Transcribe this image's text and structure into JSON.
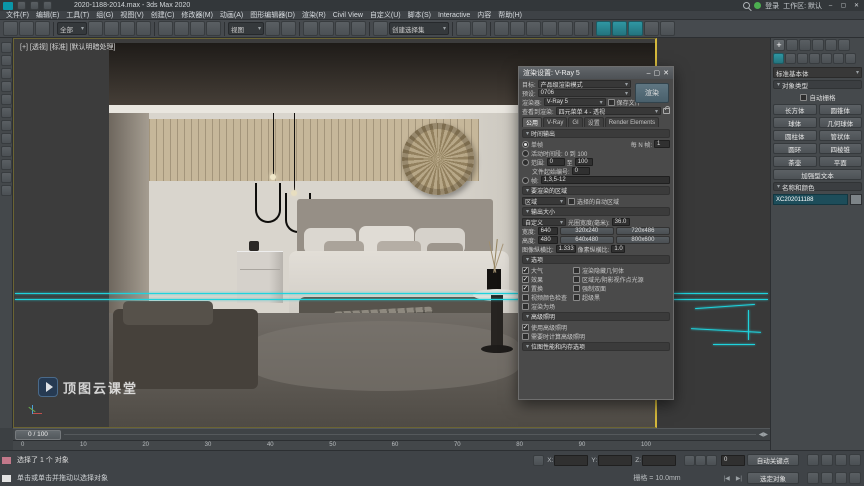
{
  "window": {
    "title": "2020-1188-2014.max - 3ds Max 2020",
    "login_label": "登录",
    "workspace_label": "工作区: 默认"
  },
  "menu": {
    "items": [
      "文件(F)",
      "编辑(E)",
      "工具(T)",
      "组(G)",
      "视图(V)",
      "创建(C)",
      "修改器(M)",
      "动画(A)",
      "图形编辑器(D)",
      "渲染(R)",
      "Civil View",
      "自定义(U)",
      "脚本(S)",
      "Interactive",
      "内容",
      "帮助(H)"
    ]
  },
  "toolbar": {
    "filter_value": "全部",
    "coord_value": "视图",
    "selection_set_placeholder": "创建选择集"
  },
  "viewport": {
    "label": "[+] [透视] [标准] [默认明暗处理]",
    "watermark": "顶图云课堂"
  },
  "dialog": {
    "title": "渲染设置: V-Ray 5",
    "target_label": "目标:",
    "target_value": "产品级渲染模式",
    "render_button": "渲染",
    "preset_label": "预设:",
    "preset_value": "0706",
    "renderer_label": "渲染器:",
    "renderer_value": "V-Ray 5",
    "save_file_label": "保存文件",
    "view_label": "查看到渲染:",
    "view_value": "四元菜单 4 - 透视",
    "tabs": [
      "公用",
      "V-Ray",
      "GI",
      "设置",
      "Render Elements"
    ],
    "time_output": {
      "header": "时间输出",
      "single": "单帧",
      "every_label": "每 N 帧:",
      "every_value": "1",
      "active_label": "活动时间段:",
      "active_value": "0 到 100",
      "range_label": "范围:",
      "range_from": "0",
      "to_label": "至",
      "range_to": "100",
      "file_label": "文件起始编号:",
      "file_value": "0",
      "frames_label": "帧:",
      "frames_value": "1,3,5-12"
    },
    "area": {
      "header": "要渲染的区域",
      "mode": "区域",
      "auto": "选择的自动区域"
    },
    "output": {
      "header": "输出大小",
      "preset": "自定义",
      "aperture_label": "光圈宽度(毫米):",
      "aperture_value": "36.0",
      "width_label": "宽度:",
      "width_value": "640",
      "height_label": "高度:",
      "height_value": "480",
      "res": [
        "320x240",
        "720x486",
        "640x480",
        "800x600"
      ],
      "img_aspect_label": "图像纵横比:",
      "img_aspect_value": "1.333",
      "px_aspect_label": "像素纵横比:",
      "px_aspect_value": "1.0"
    },
    "options": {
      "header": "选项",
      "atmos": "大气",
      "hidden": "渲染隐藏几何体",
      "effects": "效果",
      "area_lights": "区域光/阴影视作点光源",
      "disp": "置换",
      "two_sided": "强制双面",
      "video_check": "视频颜色检查",
      "super_black": "超级黑",
      "fields": "渲染为场"
    },
    "adv": {
      "header": "高级照明",
      "use": "使用高级照明",
      "compute": "需要时计算高级照明"
    },
    "bitmap_header": "位图性能和内存选项"
  },
  "panel": {
    "category_dropdown": "标准基本体",
    "object_type_header": "对象类型",
    "autogrid_label": "自动栅格",
    "buttons": [
      "长方体",
      "圆锥体",
      "球体",
      "几何球体",
      "圆柱体",
      "管状体",
      "圆环",
      "四棱锥",
      "茶壶",
      "平面"
    ],
    "text_button": "加强型文本",
    "name_color_header": "名称和颜色",
    "object_name": "XC202011188"
  },
  "timeline": {
    "slider_label": "0 / 100",
    "ticks": [
      "0",
      "10",
      "20",
      "30",
      "40",
      "50",
      "60",
      "70",
      "80",
      "90",
      "100"
    ]
  },
  "status": {
    "selection_text": "选择了 1 个 对象",
    "prompt_text": "单击或单击并拖动以选择对象",
    "grid_text": "栅格 = 10.0mm",
    "x_label": "X:",
    "y_label": "Y:",
    "z_label": "Z:",
    "auto_key_label": "自动关键点",
    "selected_label": "选定对象",
    "time_value": "0"
  },
  "icons": {
    "dropdown": "▾",
    "minimize": "–",
    "maximize": "▢",
    "close": "✕",
    "plus": "+",
    "prev": "◀",
    "next": "▶",
    "start": "|◀",
    "end": "▶|"
  },
  "colors": {
    "accent_cyan": "#1fd2dc",
    "active_viewport_border": "#d4b83c",
    "render_button": "#566a74"
  }
}
